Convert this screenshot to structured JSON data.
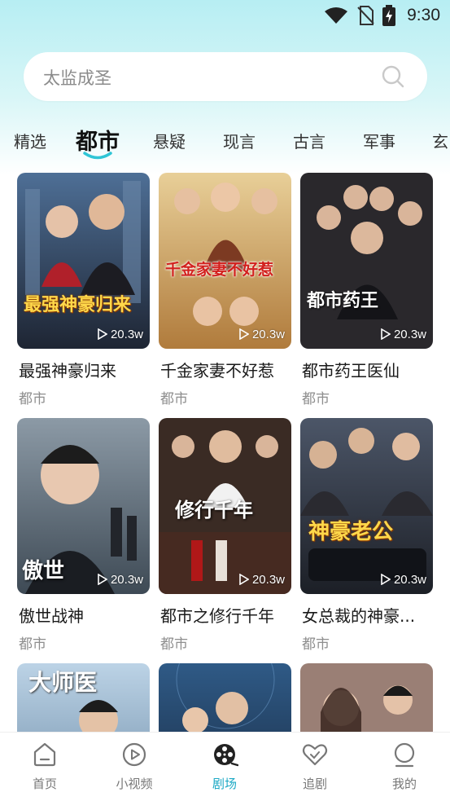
{
  "status_bar": {
    "time": "9:30",
    "icons": [
      "wifi-icon",
      "no-sim-icon",
      "battery-charging-icon"
    ]
  },
  "search": {
    "placeholder": "太监成圣",
    "icon": "search-icon"
  },
  "tabs": [
    {
      "label": "精选",
      "active": false
    },
    {
      "label": "都市",
      "active": true
    },
    {
      "label": "悬疑",
      "active": false
    },
    {
      "label": "现言",
      "active": false
    },
    {
      "label": "古言",
      "active": false
    },
    {
      "label": "军事",
      "active": false
    },
    {
      "label": "玄",
      "active": false
    }
  ],
  "dramas": [
    {
      "title": "最强神豪归来",
      "genre": "都市",
      "views": "20.3w",
      "poster_text": "最强神豪归来"
    },
    {
      "title": "千金家妻不好惹",
      "genre": "都市",
      "views": "20.3w",
      "poster_text": "千金家妻不好惹"
    },
    {
      "title": "都市药王医仙",
      "genre": "都市",
      "views": "20.3w",
      "poster_text": "都市药王"
    },
    {
      "title": "傲世战神",
      "genre": "都市",
      "views": "20.3w",
      "poster_text": "傲世"
    },
    {
      "title": "都市之修行千年",
      "genre": "都市",
      "views": "20.3w",
      "poster_text": "修行千年"
    },
    {
      "title": "女总裁的神豪...",
      "genre": "都市",
      "views": "20.3w",
      "poster_text": "神豪老公"
    },
    {
      "title": "",
      "genre": "",
      "views": "",
      "poster_text": "大师医"
    },
    {
      "title": "",
      "genre": "",
      "views": "",
      "poster_text": ""
    },
    {
      "title": "",
      "genre": "",
      "views": "",
      "poster_text": ""
    }
  ],
  "bottom_nav": [
    {
      "label": "首页",
      "icon": "home-icon",
      "active": false
    },
    {
      "label": "小视频",
      "icon": "play-circle-icon",
      "active": false
    },
    {
      "label": "剧场",
      "icon": "film-reel-icon",
      "active": true
    },
    {
      "label": "追剧",
      "icon": "heart-icon",
      "active": false
    },
    {
      "label": "我的",
      "icon": "profile-icon",
      "active": false
    }
  ],
  "colors": {
    "accent": "#1aa8c4",
    "header_gradient_top": "#b7eef3",
    "poster_palette": [
      "#3b4f6a",
      "#c79a52",
      "#2d2a2e",
      "#50606e",
      "#3a2b24",
      "#2b2f3a",
      "#6a89a3",
      "#2e4a6b",
      "#9a7f75"
    ]
  }
}
